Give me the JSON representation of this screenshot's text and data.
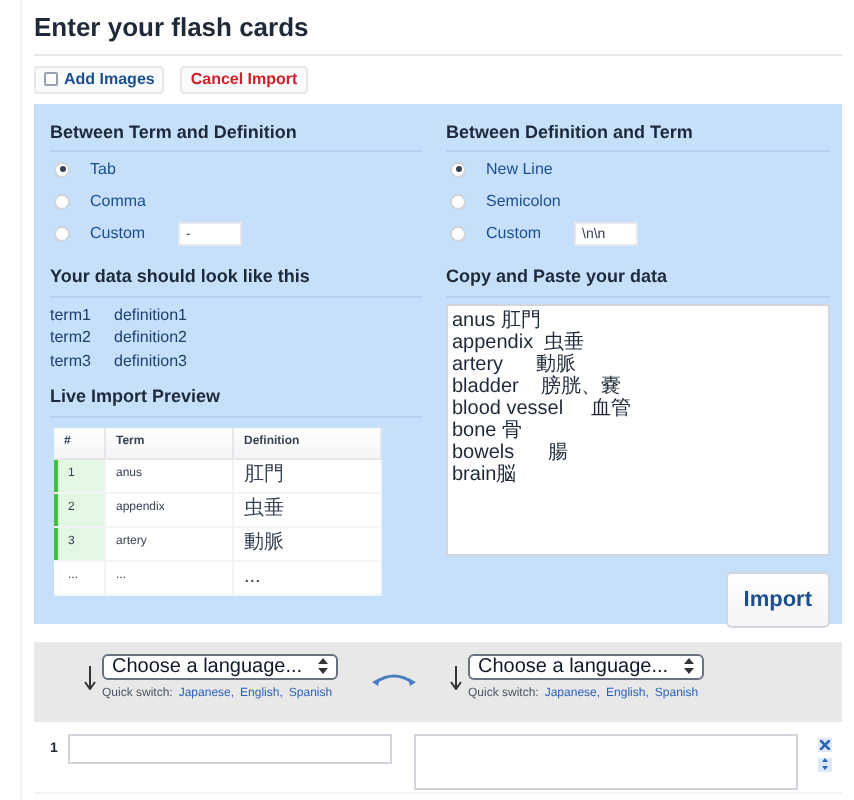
{
  "title": "Enter your flash cards",
  "buttons": [
    {
      "kind": "checkbox",
      "label": "Add Images",
      "checked": false
    },
    {
      "kind": "cancel",
      "label": "Cancel Import"
    }
  ],
  "term_separator": {
    "heading": "Between Term and Definition",
    "options": [
      {
        "label": "Tab",
        "selected": true
      },
      {
        "label": "Comma",
        "selected": false
      },
      {
        "label": "Custom",
        "selected": false,
        "value": "-"
      }
    ]
  },
  "card_separator": {
    "heading": "Between Definition and Term",
    "options": [
      {
        "label": "New Line",
        "selected": true
      },
      {
        "label": "Semicolon",
        "selected": false
      },
      {
        "label": "Custom",
        "selected": false,
        "value": "\\n\\n"
      }
    ]
  },
  "example": {
    "heading": "Your data should look like this",
    "rows": [
      [
        "term1",
        "definition1"
      ],
      [
        "term2",
        "definition2"
      ],
      [
        "term3",
        "definition3"
      ]
    ]
  },
  "preview": {
    "heading": "Live Import Preview",
    "columns": [
      "#",
      "Term",
      "Definition"
    ],
    "rows": [
      {
        "cells": [
          "1",
          "anus",
          "肛門"
        ],
        "valid": true
      },
      {
        "cells": [
          "2",
          "appendix",
          "虫垂"
        ],
        "valid": true
      },
      {
        "cells": [
          "3",
          "artery",
          "動脈"
        ],
        "valid": true
      },
      {
        "cells": [
          "...",
          "...",
          "..."
        ],
        "valid": false
      }
    ]
  },
  "paste": {
    "heading": "Copy and Paste your data",
    "lines": [
      "anus 肛門",
      "appendix  虫垂",
      "artery      動脈",
      "bladder    膀胱、嚢",
      "blood vessel     血管",
      "bone 骨",
      "bowels      腸",
      "brain脳"
    ]
  },
  "import_button": "Import",
  "languages": [
    {
      "placeholder": "Choose a language...",
      "quick_label": "Quick switch:",
      "links": [
        "Japanese,",
        "English,",
        "Spanish"
      ]
    },
    {
      "placeholder": "Choose a language...",
      "quick_label": "Quick switch:",
      "links": [
        "Japanese,",
        "English,",
        "Spanish"
      ]
    }
  ],
  "cards": [
    {
      "number": "1"
    }
  ]
}
